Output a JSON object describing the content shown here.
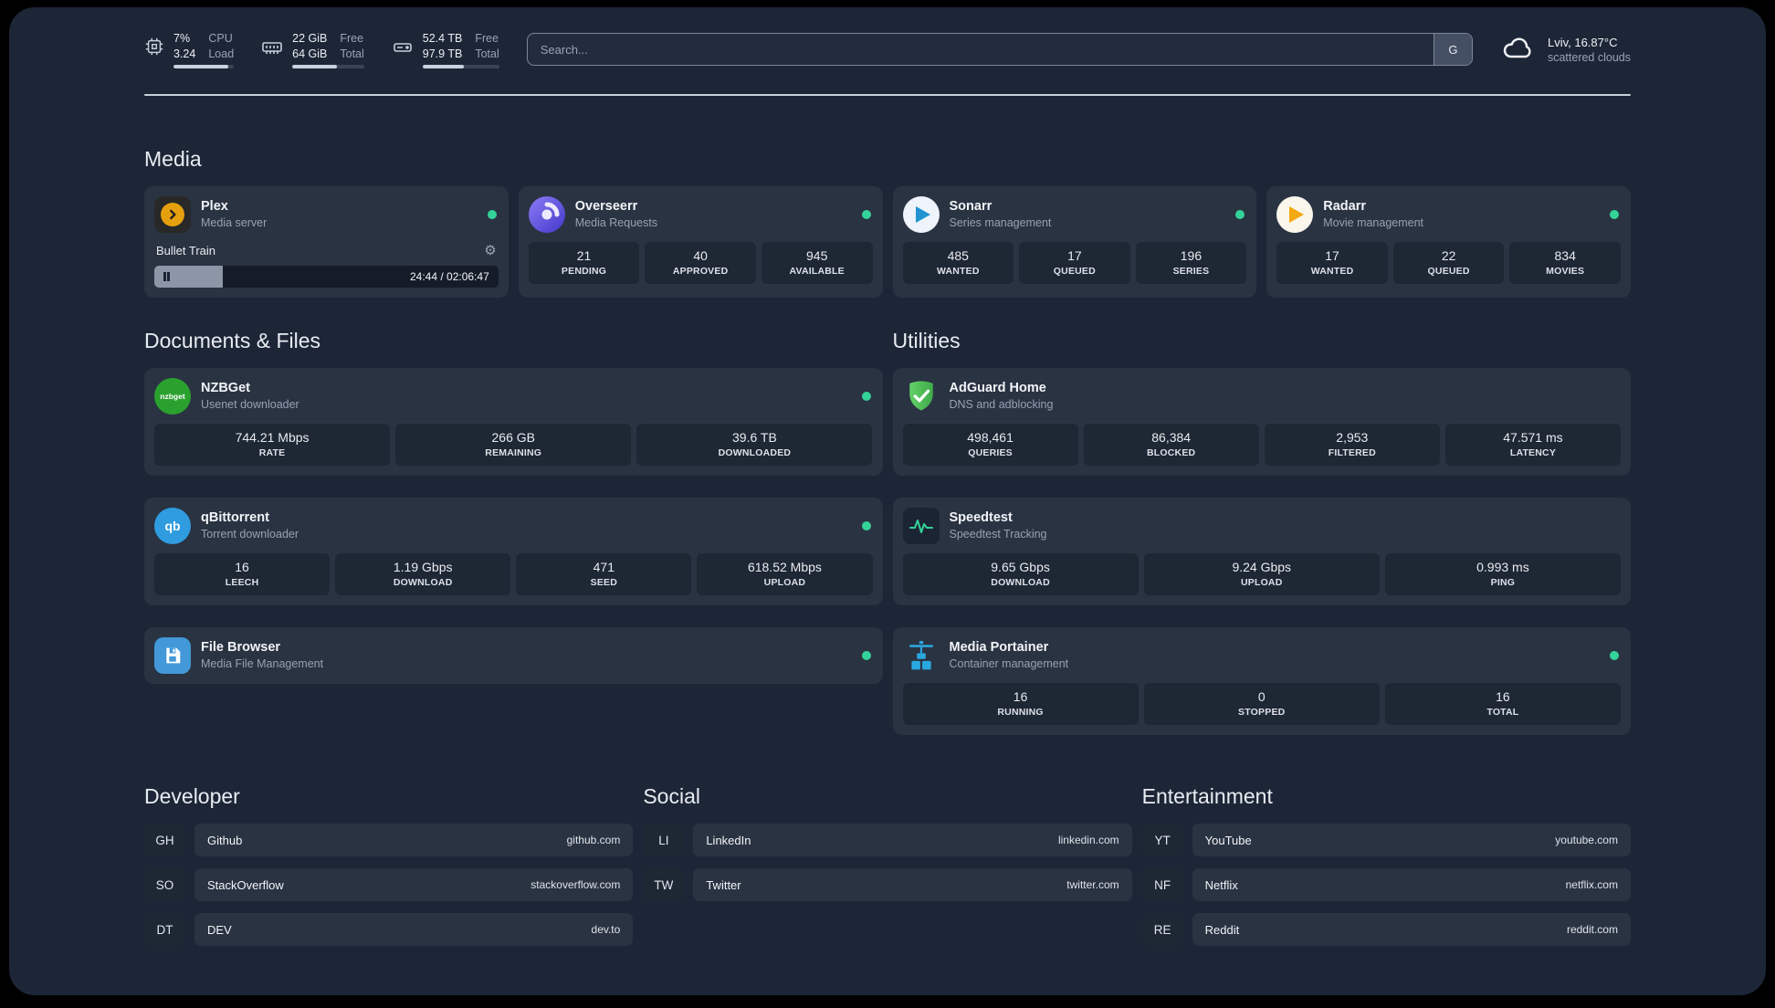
{
  "topbar": {
    "cpu": {
      "value1": "7%",
      "value2": "3.24",
      "label1": "CPU",
      "label2": "Load",
      "bar": 90
    },
    "memory": {
      "value1": "22 GiB",
      "value2": "64 GiB",
      "label1": "Free",
      "label2": "Total",
      "bar": 62
    },
    "disk": {
      "value1": "52.4 TB",
      "value2": "97.9 TB",
      "label1": "Free",
      "label2": "Total",
      "bar": 54
    },
    "search": {
      "placeholder": "Search...",
      "button": "G"
    },
    "weather": {
      "location": "Lviv, 16.87°C",
      "condition": "scattered clouds"
    }
  },
  "sections": {
    "media": "Media",
    "documents": "Documents & Files",
    "utilities": "Utilities",
    "developer": "Developer",
    "social": "Social",
    "entertainment": "Entertainment"
  },
  "colors": {
    "status_online": "#34d399",
    "plex_gold": "#e5a00d",
    "nzbget_green": "#2aa12e",
    "qbittorrent_blue": "#2f9ce0",
    "portainer_blue": "#29a8df",
    "adguard_green": "#55c25e"
  },
  "services": {
    "plex": {
      "name": "Plex",
      "subtitle": "Media server",
      "now_playing": {
        "title": "Bullet Train",
        "time": "24:44 / 02:06:47",
        "progress": 20
      }
    },
    "overseerr": {
      "name": "Overseerr",
      "subtitle": "Media Requests",
      "stats": [
        {
          "value": "21",
          "label": "PENDING"
        },
        {
          "value": "40",
          "label": "APPROVED"
        },
        {
          "value": "945",
          "label": "AVAILABLE"
        }
      ]
    },
    "sonarr": {
      "name": "Sonarr",
      "subtitle": "Series management",
      "stats": [
        {
          "value": "485",
          "label": "WANTED"
        },
        {
          "value": "17",
          "label": "QUEUED"
        },
        {
          "value": "196",
          "label": "SERIES"
        }
      ]
    },
    "radarr": {
      "name": "Radarr",
      "subtitle": "Movie management",
      "stats": [
        {
          "value": "17",
          "label": "WANTED"
        },
        {
          "value": "22",
          "label": "QUEUED"
        },
        {
          "value": "834",
          "label": "MOVIES"
        }
      ]
    },
    "nzbget": {
      "name": "NZBGet",
      "subtitle": "Usenet downloader",
      "icon_text": "nzbget",
      "stats": [
        {
          "value": "744.21 Mbps",
          "label": "RATE"
        },
        {
          "value": "266 GB",
          "label": "REMAINING"
        },
        {
          "value": "39.6 TB",
          "label": "DOWNLOADED"
        }
      ]
    },
    "qbittorrent": {
      "name": "qBittorrent",
      "subtitle": "Torrent downloader",
      "icon_text": "qb",
      "stats": [
        {
          "value": "16",
          "label": "LEECH"
        },
        {
          "value": "1.19 Gbps",
          "label": "DOWNLOAD"
        },
        {
          "value": "471",
          "label": "SEED"
        },
        {
          "value": "618.52 Mbps",
          "label": "UPLOAD"
        }
      ]
    },
    "filebrowser": {
      "name": "File Browser",
      "subtitle": "Media File Management"
    },
    "adguard": {
      "name": "AdGuard Home",
      "subtitle": "DNS and adblocking",
      "stats": [
        {
          "value": "498,461",
          "label": "QUERIES"
        },
        {
          "value": "86,384",
          "label": "BLOCKED"
        },
        {
          "value": "2,953",
          "label": "FILTERED"
        },
        {
          "value": "47.571 ms",
          "label": "LATENCY"
        }
      ]
    },
    "speedtest": {
      "name": "Speedtest",
      "subtitle": "Speedtest Tracking",
      "stats": [
        {
          "value": "9.65 Gbps",
          "label": "DOWNLOAD"
        },
        {
          "value": "9.24 Gbps",
          "label": "UPLOAD"
        },
        {
          "value": "0.993 ms",
          "label": "PING"
        }
      ]
    },
    "portainer": {
      "name": "Media Portainer",
      "subtitle": "Container management",
      "stats": [
        {
          "value": "16",
          "label": "RUNNING"
        },
        {
          "value": "0",
          "label": "STOPPED"
        },
        {
          "value": "16",
          "label": "TOTAL"
        }
      ]
    }
  },
  "bookmarks": {
    "developer": [
      {
        "abbr": "GH",
        "name": "Github",
        "url": "github.com"
      },
      {
        "abbr": "SO",
        "name": "StackOverflow",
        "url": "stackoverflow.com"
      },
      {
        "abbr": "DT",
        "name": "DEV",
        "url": "dev.to"
      }
    ],
    "social": [
      {
        "abbr": "LI",
        "name": "LinkedIn",
        "url": "linkedin.com"
      },
      {
        "abbr": "TW",
        "name": "Twitter",
        "url": "twitter.com"
      }
    ],
    "entertainment": [
      {
        "abbr": "YT",
        "name": "YouTube",
        "url": "youtube.com"
      },
      {
        "abbr": "NF",
        "name": "Netflix",
        "url": "netflix.com"
      },
      {
        "abbr": "RE",
        "name": "Reddit",
        "url": "reddit.com"
      }
    ]
  }
}
